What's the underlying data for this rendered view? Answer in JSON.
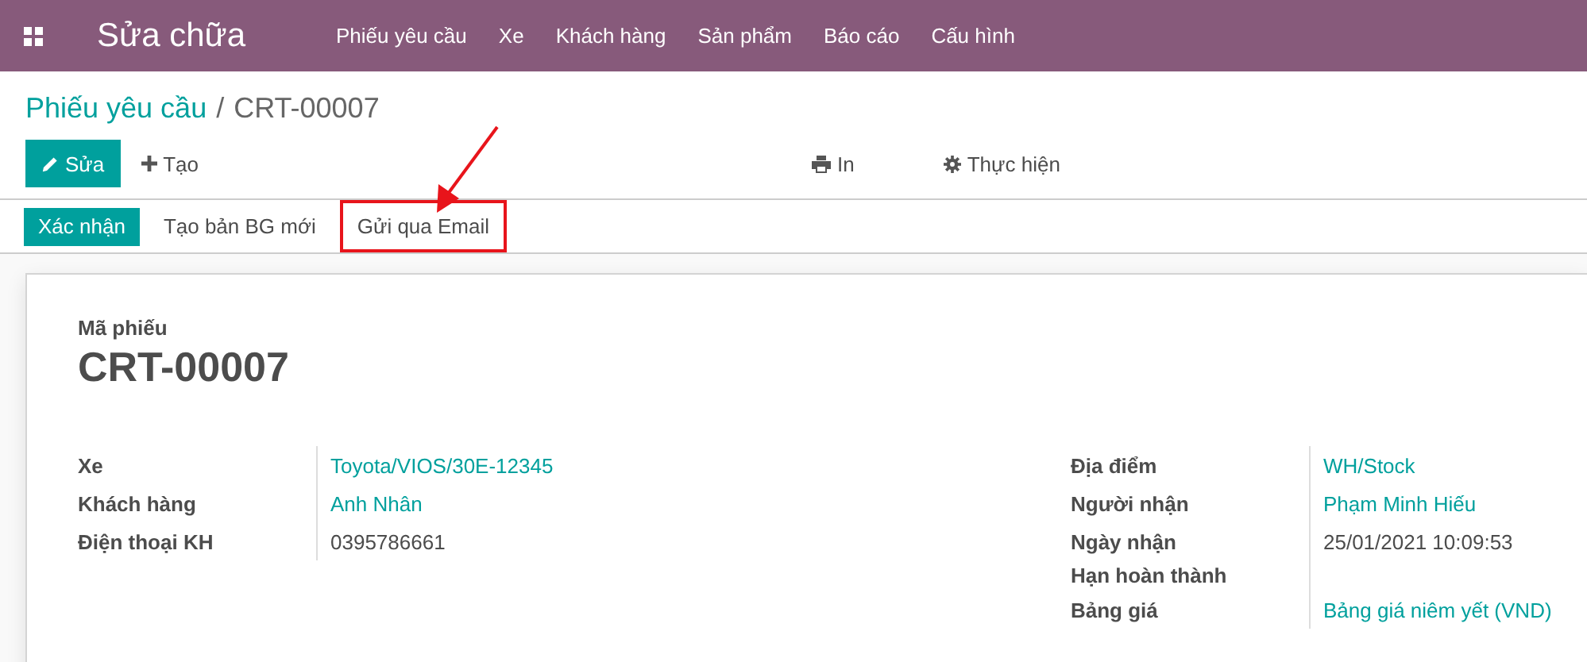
{
  "navbar": {
    "app_title": "Sửa chữa",
    "menu": [
      "Phiếu yêu cầu",
      "Xe",
      "Khách hàng",
      "Sản phẩm",
      "Báo cáo",
      "Cấu hình"
    ]
  },
  "breadcrumb": {
    "parent": "Phiếu yêu cầu",
    "separator": "/",
    "current": "CRT-00007"
  },
  "toolbar": {
    "edit": "Sửa",
    "create": "Tạo",
    "print": "In",
    "action": "Thực hiện"
  },
  "status_buttons": [
    {
      "label": "Xác nhận",
      "primary": true,
      "highlighted": false
    },
    {
      "label": "Tạo bản BG mới",
      "primary": false,
      "highlighted": false
    },
    {
      "label": "Gửi qua Email",
      "primary": false,
      "highlighted": true
    }
  ],
  "sheet": {
    "code_label": "Mã phiếu",
    "code": "CRT-00007",
    "left_fields": [
      {
        "label": "Xe",
        "value": "Toyota/VIOS/30E-12345",
        "kind": "link"
      },
      {
        "label": "Khách hàng",
        "value": "Anh Nhân",
        "kind": "link"
      },
      {
        "label": "Điện thoại KH",
        "value": "0395786661",
        "kind": "text"
      }
    ],
    "right_fields": [
      {
        "label": "Địa điểm",
        "value": "WH/Stock",
        "kind": "link"
      },
      {
        "label": "Người nhận",
        "value": "Phạm Minh Hiếu",
        "kind": "link"
      },
      {
        "label": "Ngày nhận",
        "value": "25/01/2021 10:09:53",
        "kind": "text"
      },
      {
        "label": "Hạn hoàn thành",
        "kind": "empty"
      },
      {
        "label": "Bảng giá",
        "value": "Bảng giá niêm yết (VND)",
        "kind": "link"
      }
    ]
  }
}
